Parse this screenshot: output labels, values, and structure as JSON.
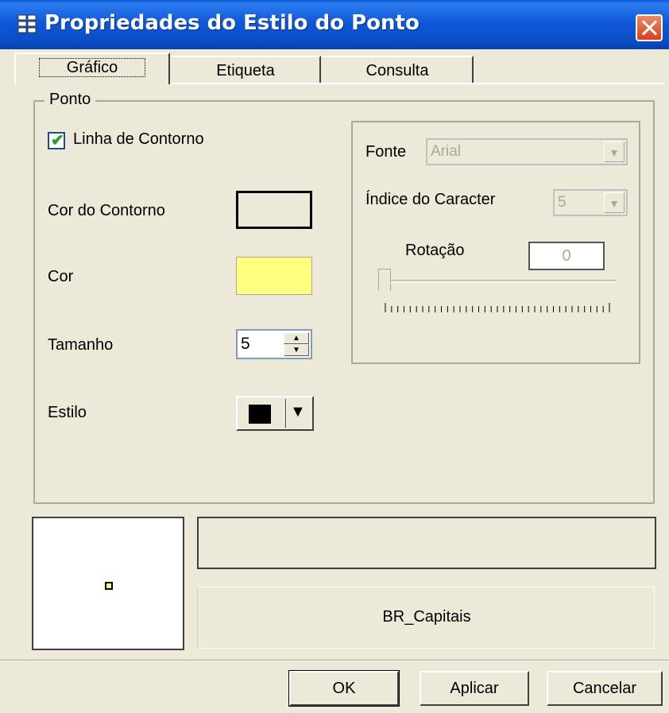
{
  "window": {
    "title": "Propriedades do Estilo do Ponto"
  },
  "tabs": [
    {
      "label": "Gráfico",
      "active": true
    },
    {
      "label": "Etiqueta",
      "active": false
    },
    {
      "label": "Consulta",
      "active": false
    }
  ],
  "group": {
    "legend": "Ponto",
    "outline_checkbox": {
      "label": "Linha de Contorno",
      "checked": true
    },
    "outline_color": {
      "label": "Cor do Contorno",
      "value": "#ece9d8"
    },
    "color": {
      "label": "Cor",
      "value": "#ffff80"
    },
    "size": {
      "label": "Tamanho",
      "value": "5"
    },
    "style": {
      "label": "Estilo",
      "value": "filled-square"
    }
  },
  "symbol": {
    "font_label": "Fonte",
    "font_value": "Arial",
    "char_index_label": "Índice do Caracter",
    "char_index_value": "5",
    "rotation_label": "Rotação",
    "rotation_value": "0"
  },
  "preview": {
    "layer_name": "BR_Capitais"
  },
  "buttons": {
    "ok": "OK",
    "apply": "Aplicar",
    "cancel": "Cancelar"
  },
  "icons": {
    "app": "properties-grid-icon",
    "close": "close-icon",
    "check": "checkmark-icon"
  }
}
